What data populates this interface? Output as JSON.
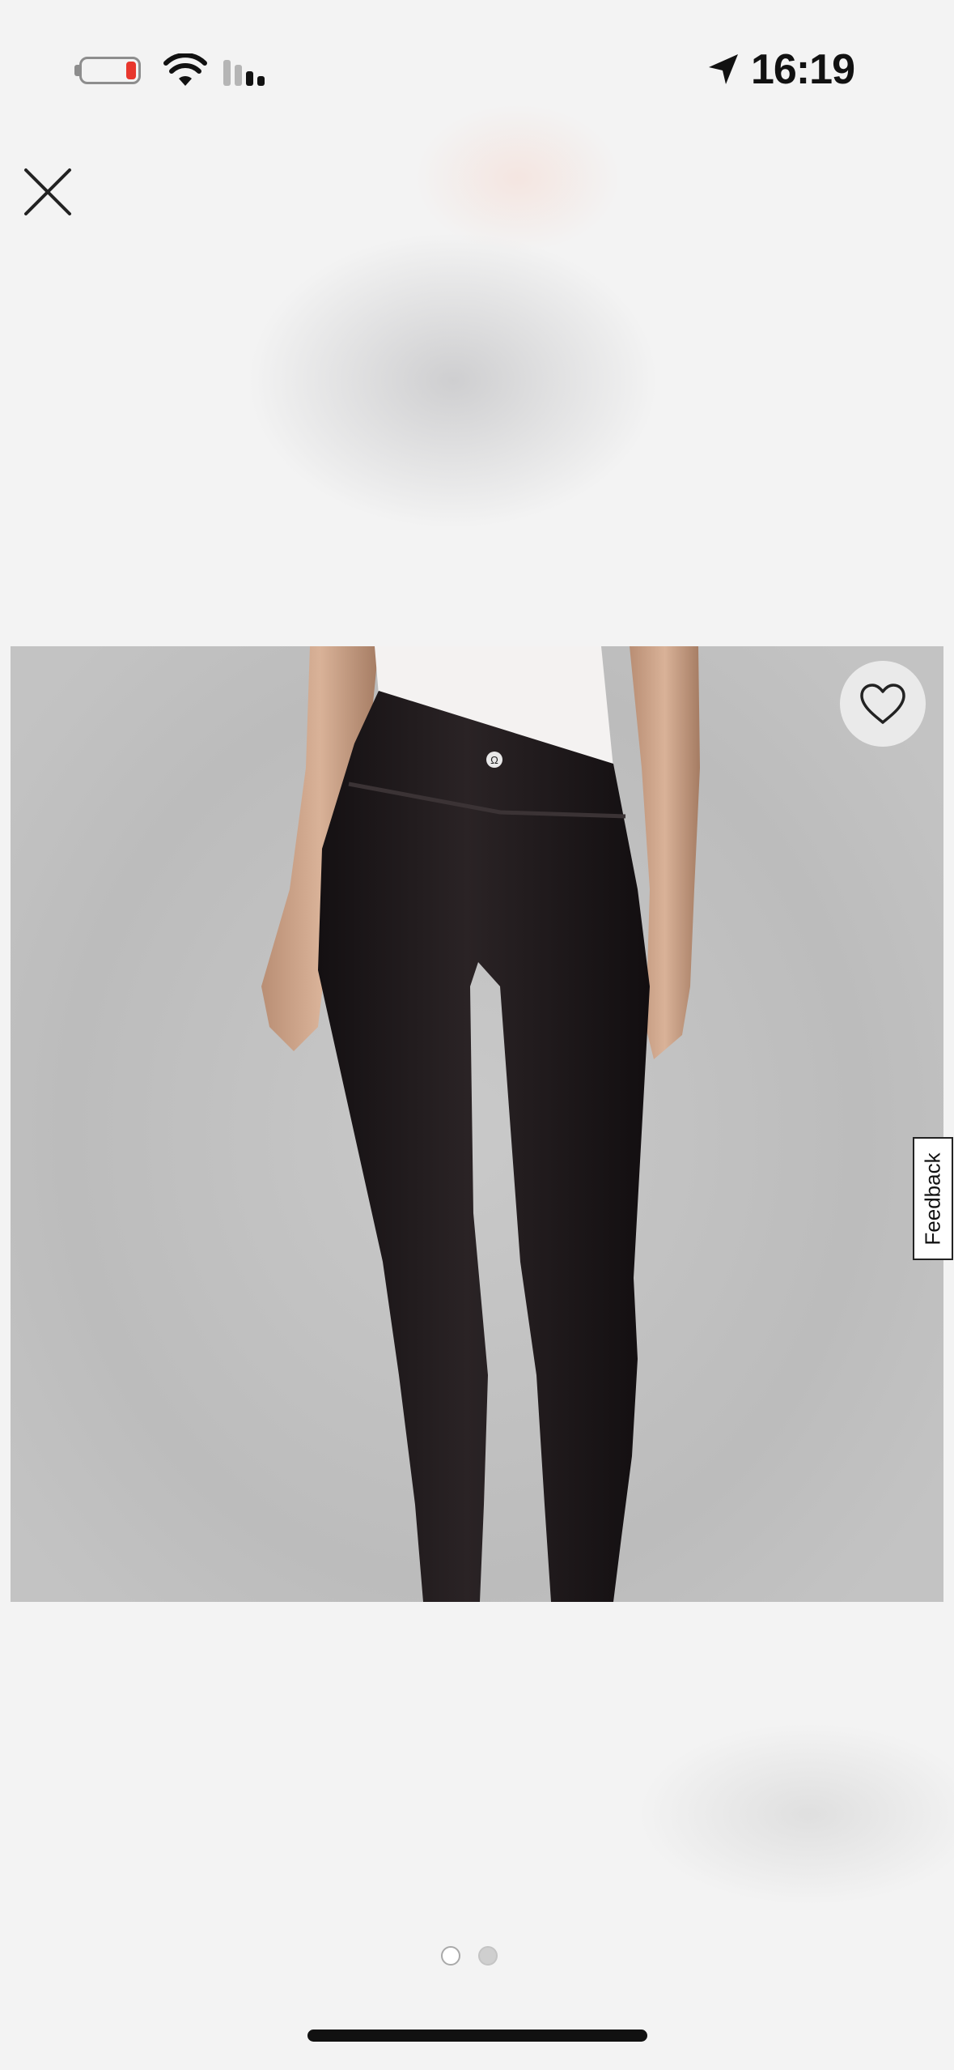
{
  "status_bar": {
    "time": "16:19",
    "battery_color": "#e8372d",
    "icons": [
      "battery-icon",
      "wifi-icon",
      "cellular-signal-icon",
      "location-arrow-icon"
    ]
  },
  "nav": {
    "close_icon": "close-icon"
  },
  "product_image": {
    "wishlist_icon": "heart-icon",
    "feedback_label": "Feedback"
  },
  "pagination": {
    "total": 2,
    "current": 1
  }
}
